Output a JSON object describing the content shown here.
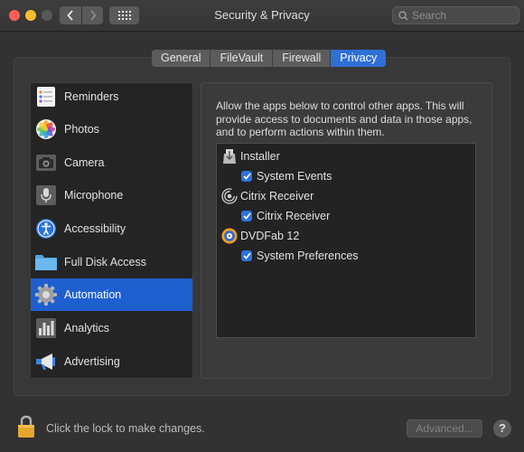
{
  "window": {
    "title": "Security & Privacy"
  },
  "search": {
    "placeholder": "Search"
  },
  "tabs": [
    {
      "label": "General"
    },
    {
      "label": "FileVault"
    },
    {
      "label": "Firewall"
    },
    {
      "label": "Privacy"
    }
  ],
  "active_tab": "Privacy",
  "sidebar": {
    "items": [
      {
        "label": "Reminders",
        "icon": "reminders-icon"
      },
      {
        "label": "Photos",
        "icon": "photos-icon"
      },
      {
        "label": "Camera",
        "icon": "camera-icon"
      },
      {
        "label": "Microphone",
        "icon": "microphone-icon"
      },
      {
        "label": "Accessibility",
        "icon": "accessibility-icon"
      },
      {
        "label": "Full Disk Access",
        "icon": "folder-icon"
      },
      {
        "label": "Automation",
        "icon": "gear-icon"
      },
      {
        "label": "Analytics",
        "icon": "analytics-icon"
      },
      {
        "label": "Advertising",
        "icon": "megaphone-icon"
      }
    ],
    "selected": "Automation"
  },
  "panel": {
    "description": "Allow the apps below to control other apps. This will provide access to documents and data in those apps, and to perform actions within them.",
    "apps": [
      {
        "name": "Installer",
        "icon": "installer-icon",
        "targets": [
          {
            "name": "System Events",
            "checked": true
          }
        ]
      },
      {
        "name": "Citrix Receiver",
        "icon": "citrix-icon",
        "targets": [
          {
            "name": "Citrix Receiver",
            "checked": true
          }
        ]
      },
      {
        "name": "DVDFab 12",
        "icon": "dvdfab-icon",
        "targets": [
          {
            "name": "System Preferences",
            "checked": true
          }
        ]
      }
    ]
  },
  "footer": {
    "lock_text": "Click the lock to make changes.",
    "advanced_label": "Advanced...",
    "help_label": "?"
  },
  "colors": {
    "accent": "#1e5fd0",
    "background": "#323232"
  }
}
